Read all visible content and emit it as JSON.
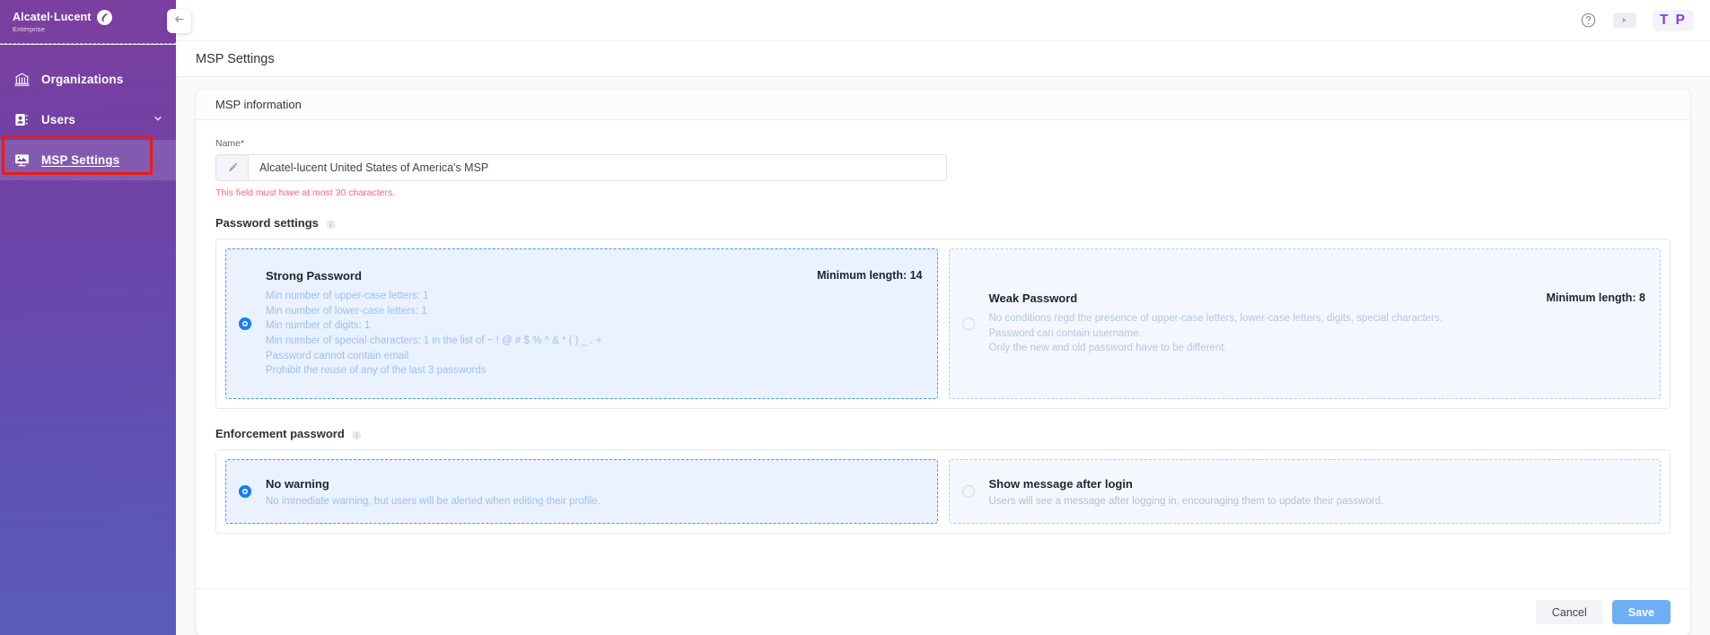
{
  "sidebar": {
    "brand": {
      "name": "Alcatel·Lucent",
      "sub": "Enterprise",
      "logo_icon": "alcatel-lucent-logo-icon"
    },
    "collapse_icon": "collapse-left-arrow-icon",
    "items": [
      {
        "label": "Organizations",
        "icon": "bank-icon",
        "active": false,
        "chevron": false
      },
      {
        "label": "Users",
        "icon": "user-card-icon",
        "active": false,
        "chevron": true
      },
      {
        "label": "MSP Settings",
        "icon": "monitor-icon",
        "active": true,
        "chevron": false
      }
    ],
    "highlight_color": "#e81c12"
  },
  "topbar": {
    "help_icon": "help-circle-icon",
    "play_icon": "play-triangle-icon",
    "avatar_initials": "T P",
    "avatar_color": "#7d3ff2"
  },
  "page": {
    "title": "MSP Settings"
  },
  "panel": {
    "header": "MSP information",
    "name_field": {
      "label": "Name",
      "required_marker": "*",
      "prefix_icon": "pencil-edit-icon",
      "value": "Alcatel-lucent United States of America's MSP",
      "placeholder": "Name",
      "error": "This field must have at most 30 characters."
    },
    "password_settings": {
      "title": "Password settings",
      "info_icon": "info-circle-icon",
      "options": [
        {
          "title": "Strong Password",
          "min_length_label": "Minimum length: 14",
          "selected": true,
          "lines": [
            "Min number of upper-case letters: 1",
            "Min number of lower-case letters: 1",
            "Min number of digits: 1",
            "Min number of special characters: 1 in the list of ~ ! @ # $ % ^ & * ( ) _ . +",
            "Password cannot contain email",
            "Prohibit the reuse of any of the last 3 passwords"
          ]
        },
        {
          "title": "Weak Password",
          "min_length_label": "Minimum length: 8",
          "selected": false,
          "lines": [
            "No conditions regd the presence of upper-case letters, lower-case letters, digits, special characters.",
            "Password can contain username.",
            "Only the new and old password have to be different."
          ]
        }
      ]
    },
    "enforcement_password": {
      "title": "Enforcement password",
      "info_icon": "info-circle-icon",
      "options": [
        {
          "title": "No warning",
          "description": "No immediate warning, but users will be alerted when editing their profile.",
          "selected": true
        },
        {
          "title": "Show message after login",
          "description": "Users will see a message after logging in, encouraging them to update their password.",
          "selected": false
        }
      ]
    },
    "footer": {
      "cancel_label": "Cancel",
      "save_label": "Save",
      "save_color": "#6eaef5"
    }
  }
}
